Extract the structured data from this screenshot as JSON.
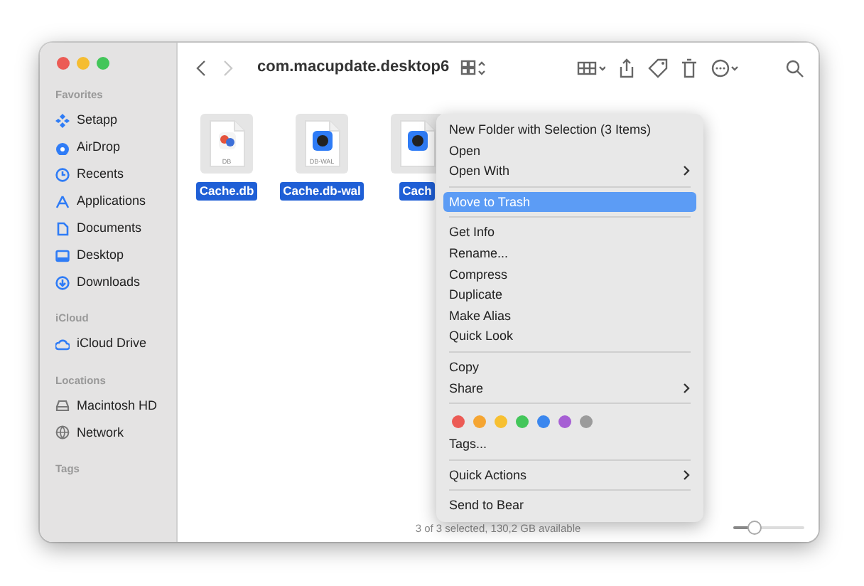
{
  "window": {
    "title": "com.macupdate.desktop6"
  },
  "toolbar": {
    "back_disabled": false,
    "forward_disabled": true
  },
  "sidebar": {
    "sections": [
      {
        "header": "Favorites",
        "items": [
          "Setapp",
          "AirDrop",
          "Recents",
          "Applications",
          "Documents",
          "Desktop",
          "Downloads"
        ]
      },
      {
        "header": "iCloud",
        "items": [
          "iCloud Drive"
        ]
      },
      {
        "header": "Locations",
        "items": [
          "Macintosh HD",
          "Network"
        ]
      },
      {
        "header": "Tags"
      }
    ]
  },
  "files": [
    {
      "name": "Cache.db",
      "badge": "DB",
      "selected": true
    },
    {
      "name": "Cache.db-wal",
      "badge": "DB-WAL",
      "selected": true
    },
    {
      "name": "Cach",
      "selected": true
    }
  ],
  "context_menu": {
    "items": [
      {
        "kind": "item",
        "label": "New Folder with Selection (3 Items)",
        "submenu": false,
        "selected": false
      },
      {
        "kind": "item",
        "label": "Open",
        "submenu": false,
        "selected": false
      },
      {
        "kind": "item",
        "label": "Open With",
        "submenu": true,
        "selected": false
      },
      {
        "kind": "separator"
      },
      {
        "kind": "item",
        "label": "Move to Trash",
        "submenu": false,
        "selected": true
      },
      {
        "kind": "separator"
      },
      {
        "kind": "item",
        "label": "Get Info",
        "submenu": false,
        "selected": false
      },
      {
        "kind": "item",
        "label": "Rename...",
        "submenu": false,
        "selected": false
      },
      {
        "kind": "item",
        "label": "Compress",
        "submenu": false,
        "selected": false
      },
      {
        "kind": "item",
        "label": "Duplicate",
        "submenu": false,
        "selected": false
      },
      {
        "kind": "item",
        "label": "Make Alias",
        "submenu": false,
        "selected": false
      },
      {
        "kind": "item",
        "label": "Quick Look",
        "submenu": false,
        "selected": false
      },
      {
        "kind": "separator"
      },
      {
        "kind": "item",
        "label": "Copy",
        "submenu": false,
        "selected": false
      },
      {
        "kind": "item",
        "label": "Share",
        "submenu": true,
        "selected": false
      },
      {
        "kind": "separator"
      },
      {
        "kind": "tags",
        "tags": [
          {
            "color": "#ec5b55"
          },
          {
            "color": "#f5a532"
          },
          {
            "color": "#f7c031"
          },
          {
            "color": "#43c65a"
          },
          {
            "color": "#3b87ee"
          },
          {
            "color": "#a65fd4"
          },
          {
            "color": "#9b9b9b"
          }
        ]
      },
      {
        "kind": "item",
        "label": "Tags...",
        "submenu": false,
        "selected": false
      },
      {
        "kind": "separator"
      },
      {
        "kind": "item",
        "label": "Quick Actions",
        "submenu": true,
        "selected": false
      },
      {
        "kind": "separator"
      },
      {
        "kind": "item",
        "label": "Send to Bear",
        "submenu": false,
        "selected": false
      }
    ]
  },
  "status_bar": {
    "text": "3 of 3 selected, 130,2 GB available"
  },
  "icon_size_slider": {
    "level": 0.3
  }
}
